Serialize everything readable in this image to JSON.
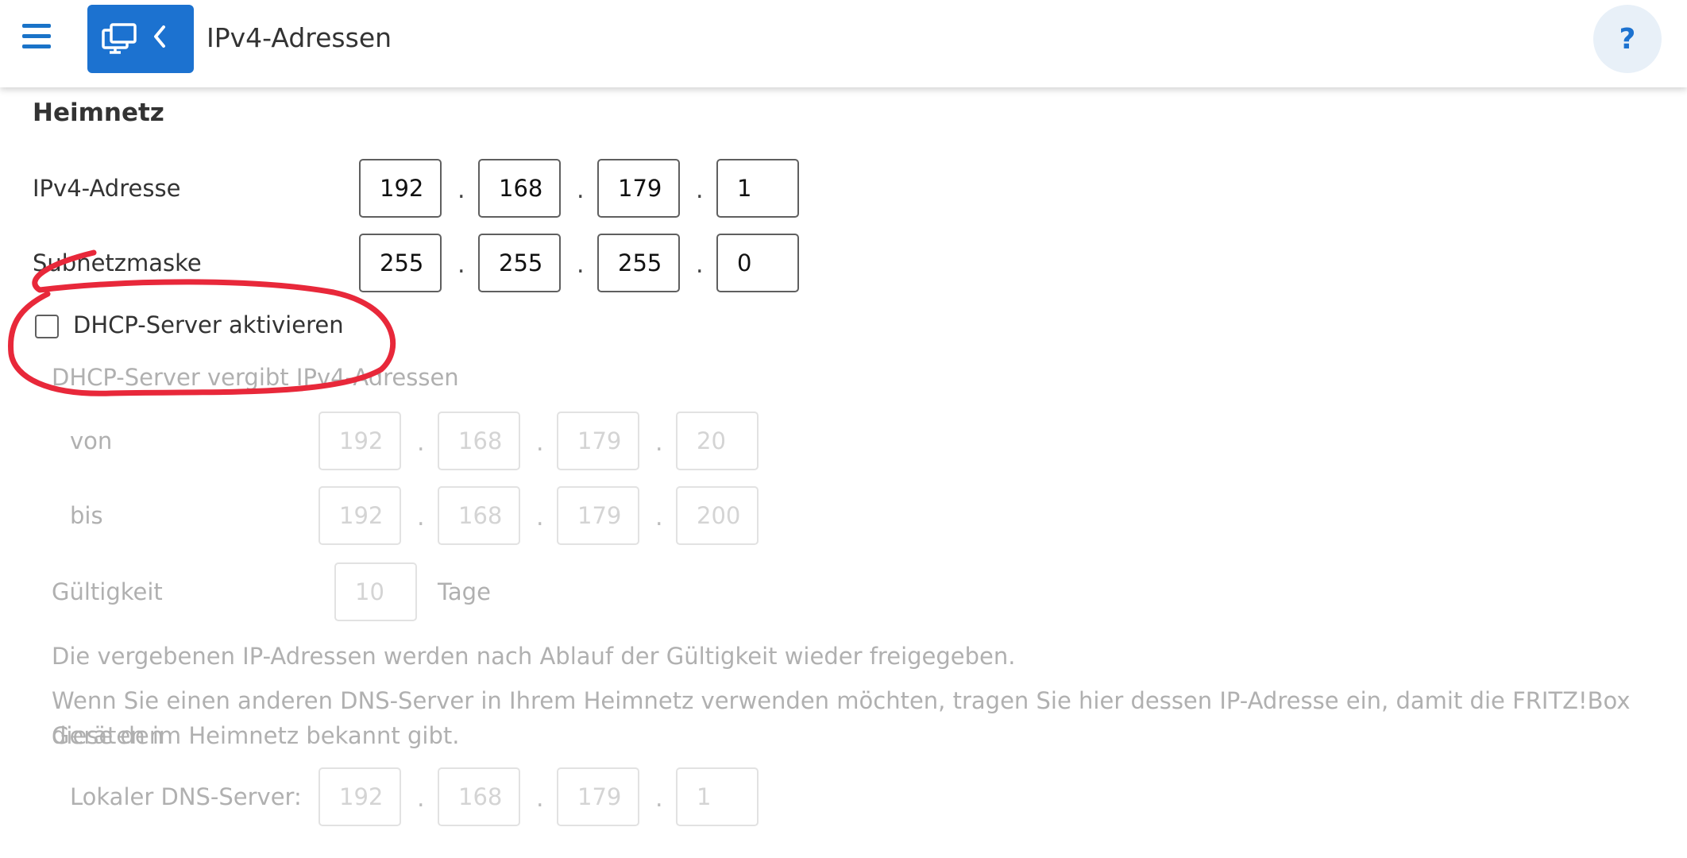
{
  "header": {
    "title": "IPv4-Adressen",
    "help_label": "?",
    "accent_color": "#1c72d0"
  },
  "section": {
    "title": "Heimnetz"
  },
  "ipv4": {
    "label": "IPv4-Adresse",
    "octets": [
      "192",
      "168",
      "179",
      "1"
    ]
  },
  "subnet": {
    "label": "Subnetzmaske",
    "octets": [
      "255",
      "255",
      "255",
      "0"
    ]
  },
  "dhcp": {
    "checkbox_label": "DHCP-Server aktivieren",
    "checked": false,
    "range_label": "DHCP-Server vergibt IPv4-Adressen",
    "from_label": "von",
    "from_octets": [
      "192",
      "168",
      "179",
      "20"
    ],
    "to_label": "bis",
    "to_octets": [
      "192",
      "168",
      "179",
      "200"
    ],
    "validity_label": "Gültigkeit",
    "validity_value": "10",
    "validity_unit": "Tage",
    "info_release": "Die vergebenen IP-Adressen werden nach Ablauf der Gültigkeit wieder freigegeben.",
    "info_dns_line1": "Wenn Sie einen anderen DNS-Server in Ihrem Heimnetz verwenden möchten, tragen Sie hier dessen IP-Adresse ein, damit die FRITZ!Box diese den",
    "info_dns_line2": "Geräten im Heimnetz bekannt gibt.",
    "dns_label": "Lokaler DNS-Server:",
    "dns_octets": [
      "192",
      "168",
      "179",
      "1"
    ]
  },
  "annotation_color": "#e8283a"
}
